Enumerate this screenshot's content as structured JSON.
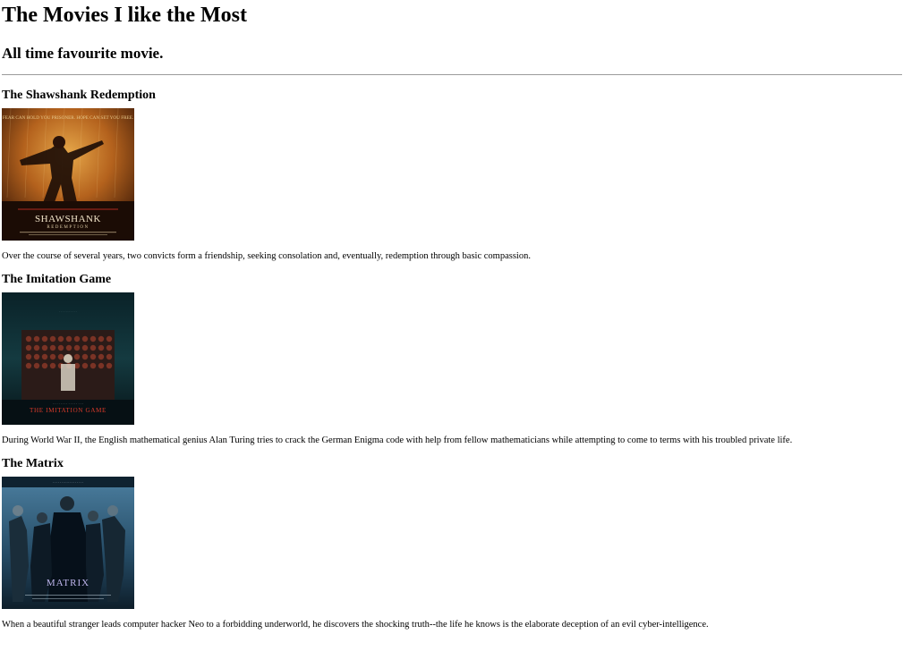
{
  "page": {
    "title": "The Movies I like the Most",
    "subtitle": "All time favourite movie."
  },
  "movies": [
    {
      "title": "The Shawshank Redemption",
      "poster_text_top": "FEAR CAN HOLD YOU PRISONER. HOPE CAN SET YOU FREE.",
      "poster_title": "SHAWSHANK",
      "poster_subtitle": "REDEMPTION",
      "description": "Over the course of several years, two convicts form a friendship, seeking consolation and, eventually, redemption through basic compassion.",
      "colors": {
        "sky": "#c9872e",
        "dark": "#3b1a08",
        "figure": "#1e0e06"
      }
    },
    {
      "title": "The Imitation Game",
      "poster_title": "THE IMITATION GAME",
      "description": "During World War II, the English mathematical genius Alan Turing tries to crack the German Enigma code with help from fellow mathematicians while attempting to come to terms with his troubled private life.",
      "colors": {
        "bg": "#0d2a2f",
        "machine": "#6a2a22",
        "title": "#d83a2a"
      }
    },
    {
      "title": "The Matrix",
      "poster_title": "MATRIX",
      "description": "When a beautiful stranger leads computer hacker Neo to a forbidding underworld, he discovers the shocking truth--the life he knows is the elaborate deception of an evil cyber-intelligence.",
      "colors": {
        "bg": "#2f5a7a",
        "figures": "#0b1a24",
        "title": "#b9b3e8"
      }
    }
  ]
}
